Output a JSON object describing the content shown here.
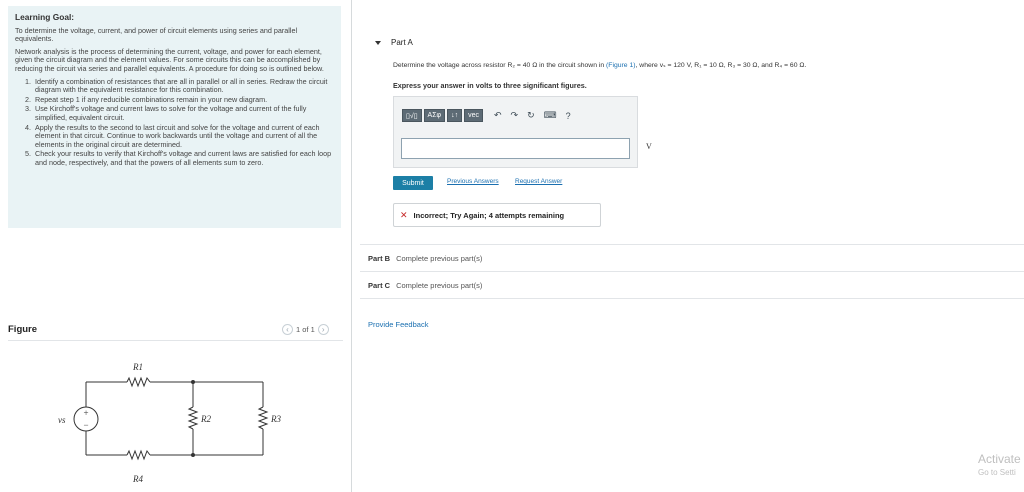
{
  "learning_goal": {
    "title": "Learning Goal:",
    "objective": "To determine the voltage, current, and power of circuit elements using series and parallel equivalents.",
    "intro": "Network analysis is the process of determining the current, voltage, and power for each element, given the circuit diagram and the element values. For some circuits this can be accomplished by reducing the circuit via series and parallel equivalents. A procedure for doing so is outlined below.",
    "steps": [
      "Identify a combination of resistances that are all in parallel or all in series. Redraw the circuit diagram with the equivalent resistance for this combination.",
      "Repeat step 1 if any reducible combinations remain in your new diagram.",
      "Use Kirchoff's voltage and current laws to solve for the voltage and current of the fully simplified, equivalent circuit.",
      "Apply the results to the second to last circuit and solve for the voltage and current of each element in that circuit. Continue to work backwards until the voltage and current of all the elements in the original circuit are determined.",
      "Check your results to verify that Kirchoff's voltage and current laws are satisfied for each loop and node, respectively, and that the powers of all elements sum to zero."
    ]
  },
  "figure": {
    "label": "Figure",
    "pager": "1 of 1",
    "circuit_labels": {
      "r1": "R1",
      "r2": "R2",
      "r3": "R3",
      "r4": "R4",
      "vs": "vs"
    }
  },
  "partA": {
    "title": "Part A",
    "question_prefix": "Determine the voltage across resistor R₂ = 40 Ω in the circuit shown in",
    "figure_link": "(Figure 1)",
    "question_suffix": ", where vₛ = 120 V, R₁ = 10 Ω, R₃ = 30 Ω, and R₄ = 60 Ω.",
    "instruction": "Express your answer in volts to three significant figures.",
    "toolbar": {
      "templates": "▯√▯",
      "greek": "ΑΣφ",
      "arrows": "↓↑",
      "vec": "vec",
      "undo": "↶",
      "redo": "↷",
      "reset": "↻",
      "keyboard": "⌨",
      "help": "?"
    },
    "answer_value": "",
    "unit": "V",
    "submit_label": "Submit",
    "previous_answers": "Previous Answers",
    "request_answer": "Request Answer",
    "feedback": "Incorrect; Try Again; 4 attempts remaining"
  },
  "partB": {
    "label": "Part B",
    "status": "Complete previous part(s)"
  },
  "partC": {
    "label": "Part C",
    "status": "Complete previous part(s)"
  },
  "provide_feedback": "Provide Feedback",
  "watermark": {
    "line1": "Activate",
    "line2": "Go to Setti"
  }
}
